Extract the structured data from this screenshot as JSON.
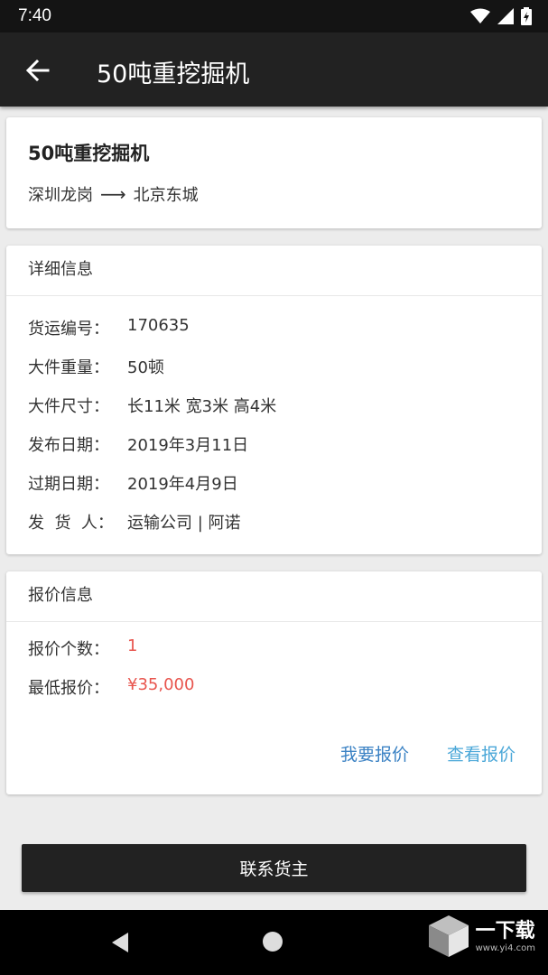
{
  "status_bar": {
    "time": "7:40",
    "icons": [
      "wifi-icon",
      "signal-icon",
      "battery-icon"
    ]
  },
  "app_bar": {
    "title": "50吨重挖掘机",
    "back_icon": "arrow-left-icon"
  },
  "summary": {
    "title": "50吨重挖掘机",
    "from": "深圳龙岗",
    "arrow": "⟶",
    "to": "北京东城"
  },
  "details": {
    "header": "详细信息",
    "rows": [
      {
        "label": "货运编号：",
        "value": "170635"
      },
      {
        "label": "大件重量：",
        "value": "50顿"
      },
      {
        "label": "大件尺寸：",
        "value": "长11米 宽3米 高4米"
      },
      {
        "label": "发布日期：",
        "value": "2019年3月11日"
      },
      {
        "label": "过期日期：",
        "value": "2019年4月9日"
      },
      {
        "label": "发  货  人：",
        "value": "运输公司 | 阿诺"
      }
    ]
  },
  "quotes": {
    "header": "报价信息",
    "count_label": "报价个数：",
    "count_value": "1",
    "min_label": "最低报价：",
    "min_value": "¥35,000",
    "quote_link": "我要报价",
    "view_link": "查看报价"
  },
  "contact_button": "联系货主",
  "watermark": {
    "text": "一下载",
    "url": "www.yi4.com"
  },
  "colors": {
    "app_bar": "#222222",
    "accent_red": "#e8554e",
    "link_blue": "#3b82c4",
    "link_light_blue": "#4aa7d8"
  }
}
